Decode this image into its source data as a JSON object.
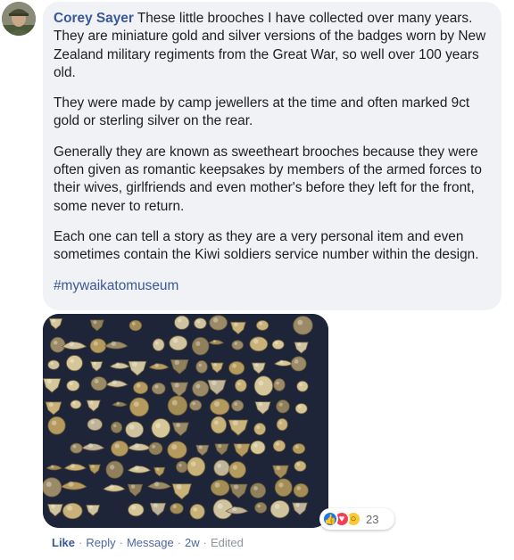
{
  "comment": {
    "author": "Corey Sayer",
    "paragraphs": [
      "These little brooches I have collected over many years. They are miniature gold and silver versions of the badges worn by New Zealand military regiments from the Great War, so well over 100 years old.",
      "They were made by camp jewellers at the time and often marked 9ct gold or sterling silver on the rear.",
      "Generally they are known as sweetheart brooches because they were often given as romantic keepsakes by members of the armed forces to their wives, girlfriends and even mother's before they left for the front, some never to return.",
      "Each one can tell a story as they are a very personal item and even sometimes contain the Kiwi soldiers service number within the design."
    ],
    "hashtag": "#mywaikatomuseum"
  },
  "reactions": {
    "types": [
      "like-icon",
      "love-icon",
      "wow-icon"
    ],
    "count": "23"
  },
  "actions": {
    "like": "Like",
    "reply": "Reply",
    "message": "Message",
    "time": "2w",
    "edited": "Edited",
    "separator": "·"
  },
  "colors": {
    "link": "#385898",
    "bubble": "#f0f2f5",
    "meta": "#8d949e",
    "photo_bg": "#1e2333"
  }
}
